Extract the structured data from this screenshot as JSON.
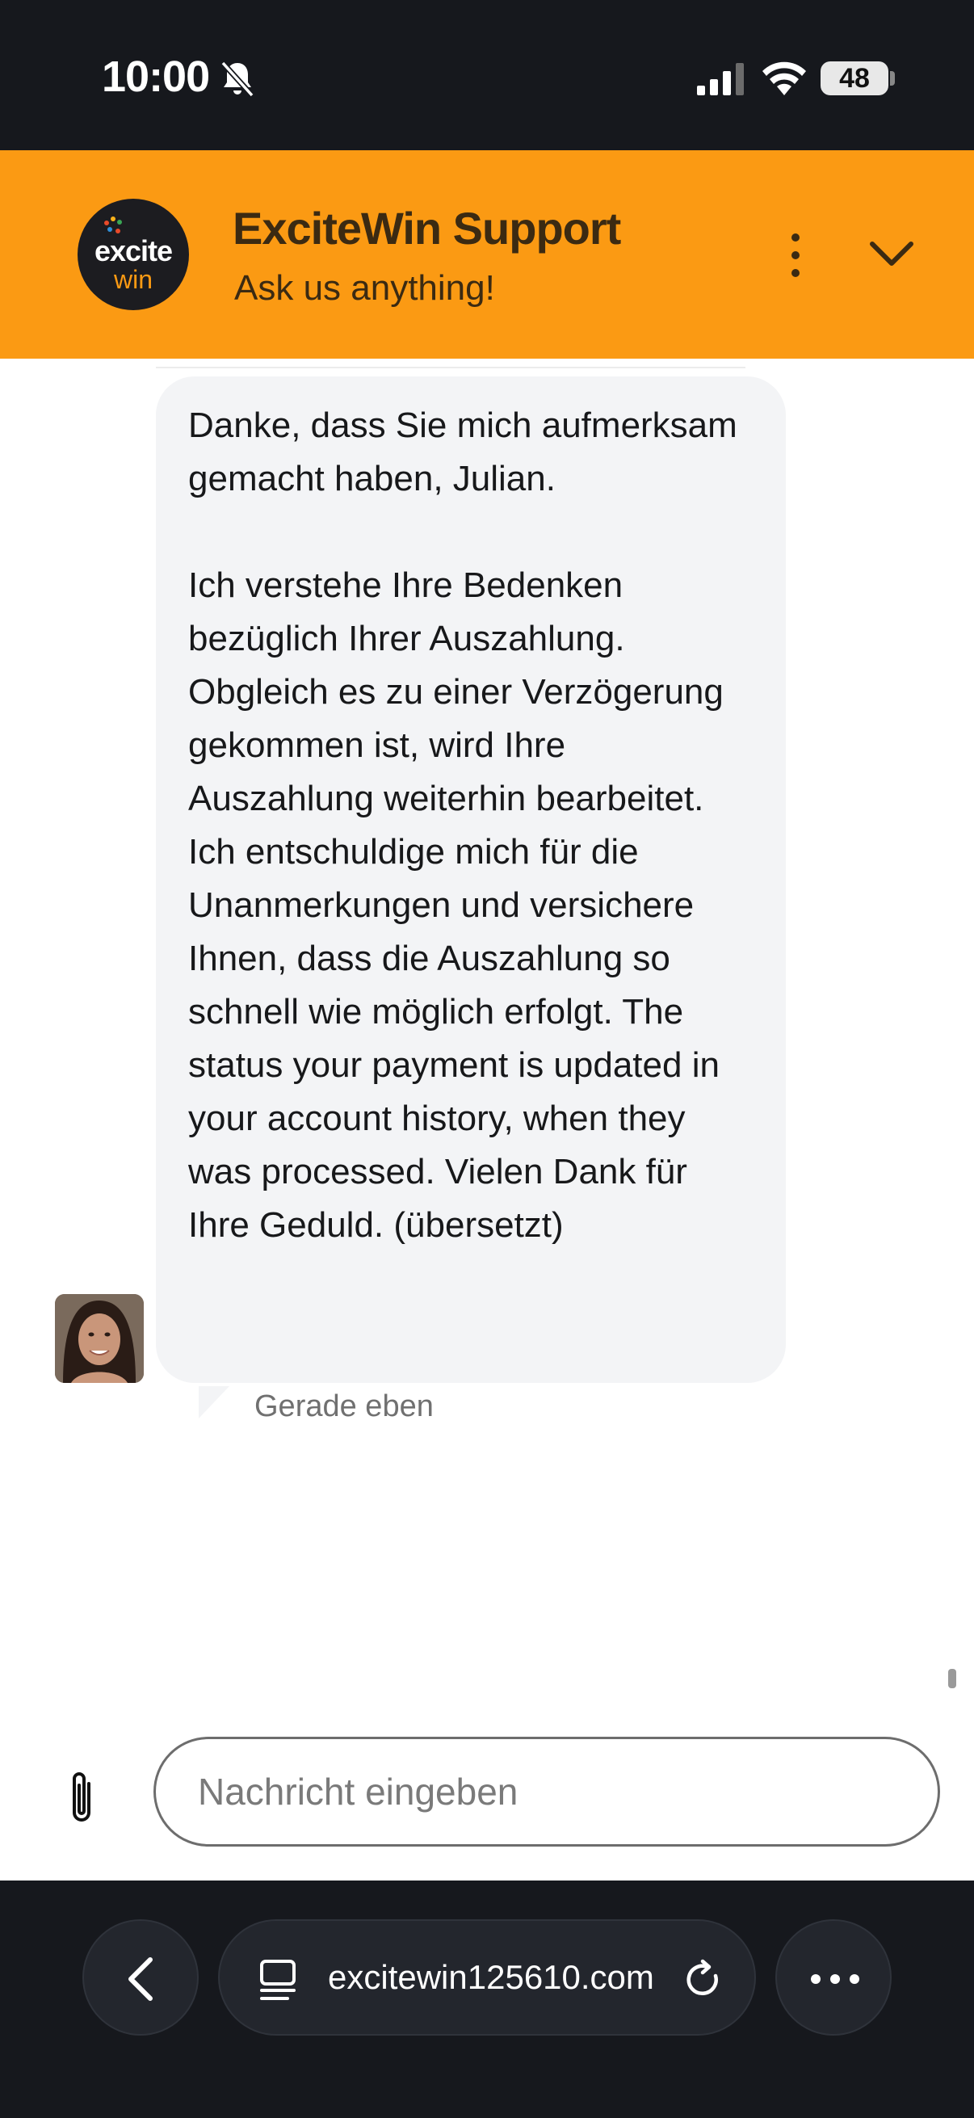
{
  "status_bar": {
    "time": "10:00",
    "battery": "48",
    "icons": [
      "bell-slash-icon",
      "cellular-signal-icon",
      "wifi-icon",
      "battery-icon"
    ]
  },
  "header": {
    "logo_text_top": "excite",
    "logo_text_bottom": "win",
    "title": "ExciteWin Support",
    "subtitle": "Ask us anything!",
    "brand_color": "#fb9a13"
  },
  "chat": {
    "message": {
      "paragraph1": "Danke, dass Sie mich aufmerksam gemacht haben, Julian.",
      "paragraph2": "Ich verstehe Ihre Bedenken bezüglich Ihrer Auszahlung. Obgleich es zu einer Verzögerung gekommen ist, wird Ihre Auszahlung weiterhin bearbeitet. Ich entschuldige mich für die Unanmerkungen und versichere Ihnen, dass die Auszahlung so schnell wie möglich erfolgt. The status your payment is updated in your account history, when they was processed. Vielen Dank für Ihre Geduld. (übersetzt)",
      "time": "Gerade eben"
    }
  },
  "composer": {
    "placeholder": "Nachricht eingeben",
    "value": ""
  },
  "browser": {
    "url": "excitewin125610.com"
  }
}
